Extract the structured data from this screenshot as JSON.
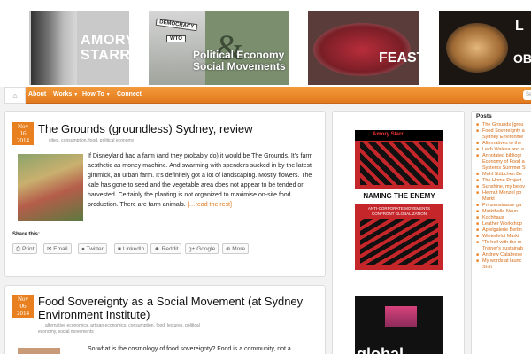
{
  "banner": {
    "tile1_caption": [
      "AMORY",
      "STARR"
    ],
    "tile2_signs": [
      "DEMOCRACY",
      "WTO"
    ],
    "tile2_amp": "&",
    "tile2_caption": [
      "Political Economy",
      "Social Movements"
    ],
    "tile3_caption": "FEAST",
    "tile4_caption_top": "L",
    "tile4_caption_bottom": "OB."
  },
  "nav": {
    "items": [
      "About",
      "Works",
      "How To",
      "Connect"
    ],
    "search_placeholder": "Se"
  },
  "posts": [
    {
      "date_month": "Nov",
      "date_day": "16",
      "date_year": "2014",
      "title": "The Grounds (groundless) Sydney, review",
      "meta": "cities, consumption, food, political economy",
      "excerpt": "If Disneyland had a farm (and they probably do)  it would be The Grounds.  It's farm aesthetic as money machine.  And swarming with spenders sucked in by the latest gimmick,  an urban farm. It's definitely got a lot of landscaping.  Mostly flowers.  The kale has gone to seed and the vegetable area does not appear to be tended or harvested.  Certainly the planting is not organized to maximise on-site food production. There are farm animals.",
      "more": "[…read the rest]",
      "share_label": "Share this:",
      "share_buttons": [
        "Print",
        "Email",
        "Twitter",
        "LinkedIn",
        "Reddit",
        "Google",
        "More"
      ]
    },
    {
      "date_month": "Nov",
      "date_day": "06",
      "date_year": "2014",
      "title_line1": "Food Sovereignty as a Social Movement (at Sydney",
      "title_line2": "Environment Institute)",
      "meta_line1": "alternative economics, artisan economics, consumption, food, lectures, political",
      "meta_line2": "economy, social movements",
      "excerpt": "So what is the cosmology of food sovereignty? Food is a community, not a"
    }
  ],
  "books": [
    {
      "author": "Amory Starr",
      "title": "NAMING THE ENEMY",
      "subtitle": "ANTI-CORPORATE MOVEMENTS CONFRONT GLOBALIZATION"
    },
    {
      "title": "global"
    }
  ],
  "sidebar": {
    "title": "Posts",
    "items": [
      "The Grounds (grou",
      "Food Sovereignty a",
      "Sydney Environme",
      "Alternatives to the",
      "Lech Walęsa and a",
      "Annotated bibliogr",
      "Economy of Food a",
      "Systems Summer S",
      "Mehl Stübchen Be",
      "The Home Project,",
      "Sunshine, my belov",
      "Helmut Menzel po",
      "Markt",
      "Prinzenstrasse ga",
      "Markthalle Neun",
      "Kochhaus",
      "Leather Workshop",
      "Apfelgalerie Berlin",
      "Winterfeldt Markt",
      "\"To hell with the m",
      "Trainer's sustainab",
      "Andrew Calabrese",
      "My words at launc",
      "Shift"
    ]
  },
  "colors": {
    "accent": "#e8801f",
    "link": "#d46a15"
  }
}
